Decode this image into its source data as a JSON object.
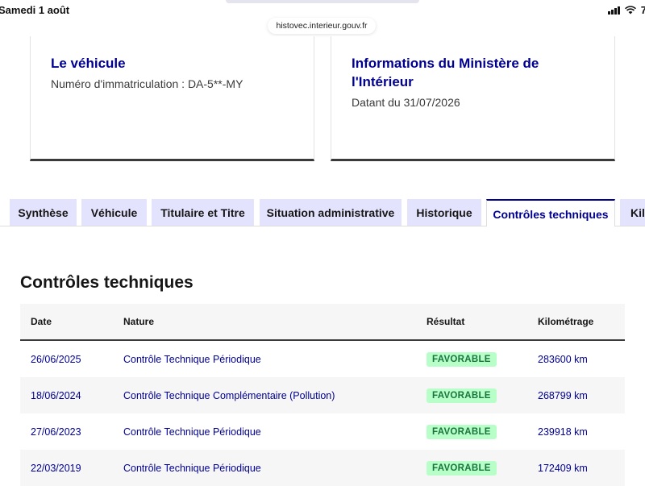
{
  "status_bar": {
    "time": "Samedi 1 août",
    "battery": "7"
  },
  "browser": {
    "url": "histovec.interieur.gouv.fr"
  },
  "cards": {
    "vehicle": {
      "title": "Le véhicule",
      "text": "Numéro d'immatriculation : DA-5**-MY"
    },
    "ministry": {
      "title": "Informations du Ministère de l'Intérieur",
      "text": "Datant du 31/07/2026"
    }
  },
  "tabs": [
    {
      "label": "Synthèse",
      "active": false
    },
    {
      "label": "Véhicule",
      "active": false
    },
    {
      "label": "Titulaire et Titre",
      "active": false
    },
    {
      "label": "Situation administrative",
      "active": false
    },
    {
      "label": "Historique",
      "active": false
    },
    {
      "label": "Contrôles techniques",
      "active": true
    },
    {
      "label": "Kilo",
      "active": false
    }
  ],
  "section": {
    "title": "Contrôles techniques"
  },
  "table": {
    "headers": {
      "date": "Date",
      "nature": "Nature",
      "result": "Résultat",
      "km": "Kilométrage"
    },
    "rows": [
      {
        "date": "26/06/2025",
        "nature": "Contrôle Technique Périodique",
        "result": "FAVORABLE",
        "km": "283600 km"
      },
      {
        "date": "18/06/2024",
        "nature": "Contrôle Technique Complémentaire (Pollution)",
        "result": "FAVORABLE",
        "km": "268799 km"
      },
      {
        "date": "27/06/2023",
        "nature": "Contrôle Technique Périodique",
        "result": "FAVORABLE",
        "km": "239918 km"
      },
      {
        "date": "22/03/2019",
        "nature": "Contrôle Technique Périodique",
        "result": "FAVORABLE",
        "km": "172409 km"
      }
    ]
  },
  "colors": {
    "accent": "#000091",
    "tab_bg": "#e3e3fd",
    "badge_bg": "#b8fec9",
    "badge_text": "#18753c"
  }
}
